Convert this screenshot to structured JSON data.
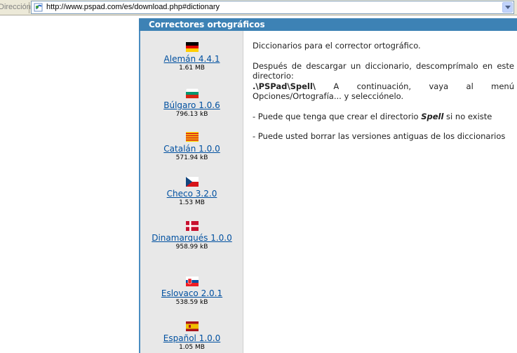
{
  "address_bar": {
    "label": "Dirección",
    "url": "http://www.pspad.com/es/download.php#dictionary"
  },
  "section": {
    "title": "Correctores ortográficos"
  },
  "dictionaries": [
    {
      "name": "Alemán 4.4.1",
      "size": "1.61 MB",
      "flag": "germany-flag"
    },
    {
      "name": "Búlgaro 1.0.6",
      "size": "796.13 kB",
      "flag": "bulgaria-flag"
    },
    {
      "name": "Catalán 1.0.0",
      "size": "571.94 kB",
      "flag": "catalonia-flag"
    },
    {
      "name": "Checo 3.2.0",
      "size": "1.53 MB",
      "flag": "czech-flag"
    },
    {
      "name": "Dinamarqués 1.0.0",
      "size": "958.99 kB",
      "flag": "denmark-flag"
    },
    {
      "name": "Eslovaco 2.0.1",
      "size": "538.59 kB",
      "flag": "slovakia-flag"
    },
    {
      "name": "Español 1.0.0",
      "size": "1.05 MB",
      "flag": "spain-flag"
    }
  ],
  "main": {
    "intro": "Diccionarios para el corrector ortográfico.",
    "install_prefix": "Después de descargar un diccionario, descomprímalo en este directorio:",
    "install_path": ".\\PSPad\\Spell\\",
    "install_suffix": " A continuación, vaya al menú Opciones/Ortografía... y selecciónelo.",
    "note1_prefix": "- Puede que tenga que crear el directorio ",
    "note1_em": "Spell",
    "note1_suffix": " si no existe",
    "note2": "- Puede usted borrar las versiones antiguas de los diccionarios"
  },
  "colors": {
    "header_bg": "#3d82b5",
    "link": "#0050a0",
    "sidebar_bg": "#e8e8e8"
  }
}
